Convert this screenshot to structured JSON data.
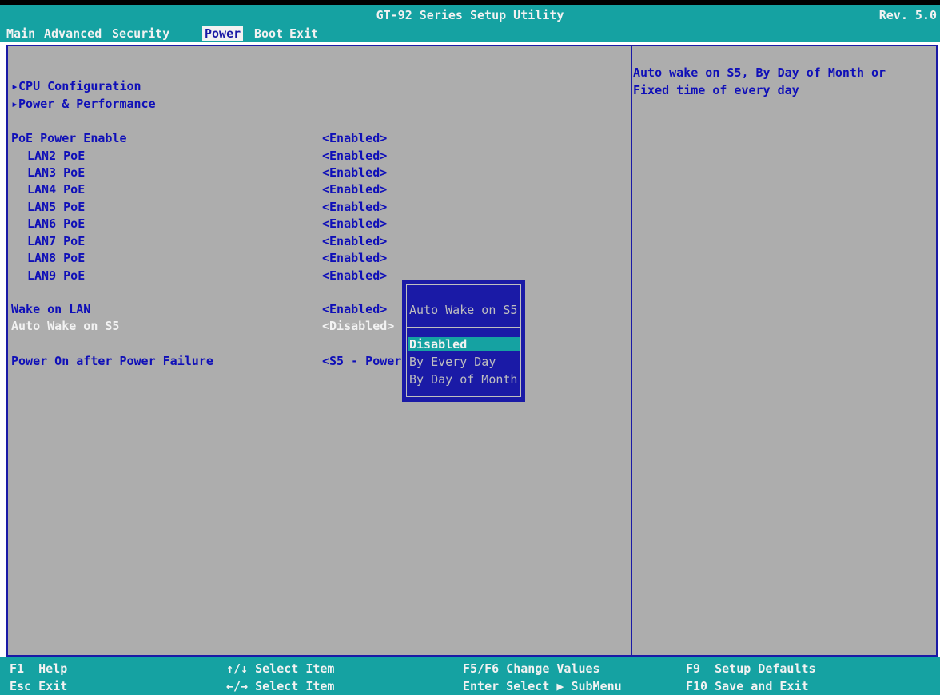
{
  "header": {
    "title": "GT-92 Series Setup Utility",
    "revision": "Rev. 5.0"
  },
  "menu": [
    "Main",
    "Advanced",
    "Security",
    "Power",
    "Boot",
    "Exit"
  ],
  "menu_active": "Power",
  "submenus": [
    "▸CPU Configuration",
    "▸Power & Performance"
  ],
  "settings": [
    {
      "label": "PoE Power Enable",
      "value": "<Enabled>"
    },
    {
      "label": "LAN2 PoE",
      "value": "<Enabled>"
    },
    {
      "label": "LAN3 PoE",
      "value": "<Enabled>"
    },
    {
      "label": "LAN4 PoE",
      "value": "<Enabled>"
    },
    {
      "label": "LAN5 PoE",
      "value": "<Enabled>"
    },
    {
      "label": "LAN6 PoE",
      "value": "<Enabled>"
    },
    {
      "label": "LAN7 PoE",
      "value": "<Enabled>"
    },
    {
      "label": "LAN8 PoE",
      "value": "<Enabled>"
    },
    {
      "label": "LAN9 PoE",
      "value": "<Enabled>"
    },
    {
      "label": "Wake on LAN",
      "value": "<Enabled>"
    },
    {
      "label": "Auto Wake on S5",
      "value": "<Disabled>"
    },
    {
      "label": "Power On after Power Failure",
      "value": "<S5 - Power"
    }
  ],
  "help": {
    "text": "Auto wake on S5, By Day of Month or Fixed time of every day"
  },
  "popup": {
    "title": "Auto Wake on S5",
    "options": [
      "Disabled",
      "By Every Day",
      "By Day of Month"
    ],
    "selected": "Disabled"
  },
  "keys": {
    "f1": "F1  Help",
    "esc": "Esc Exit",
    "updown": "↑/↓ Select Item",
    "leftright": "←/→ Select Item",
    "f5f6": "F5/F6 Change Values",
    "enter": "Enter Select ▶ SubMenu",
    "f9": "F9  Setup Defaults",
    "f10": "F10 Save and Exit"
  },
  "colors": {
    "bar": "#15a2a2",
    "panel": "#adadad",
    "text_blue": "#0f0fb8",
    "popup_bg": "#1a1aa6"
  }
}
